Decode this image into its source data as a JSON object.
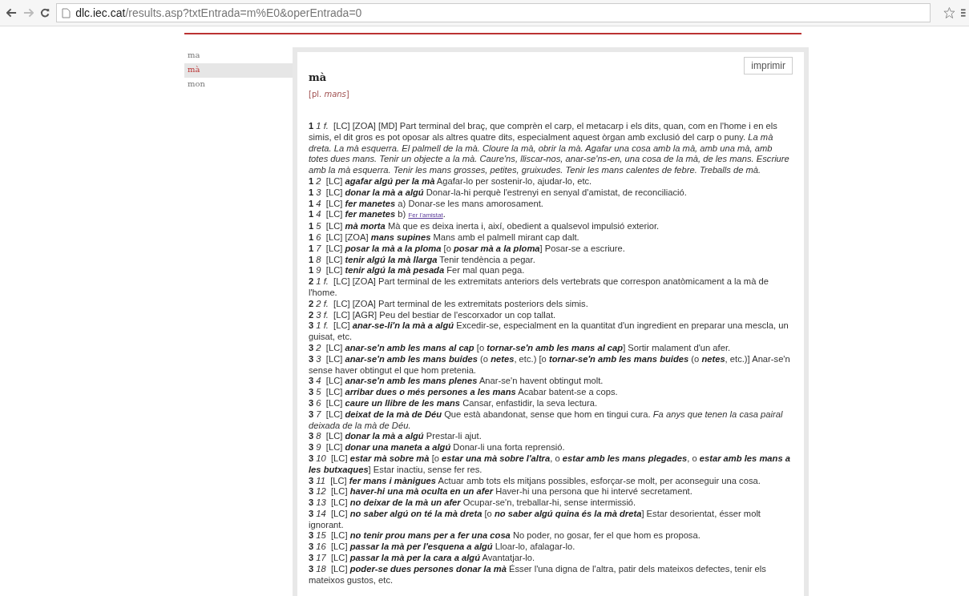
{
  "browser": {
    "url_host": "dlc.iec.cat",
    "url_path": "/results.asp?txtEntrada=m%E0&operEntrada=0"
  },
  "sidebar": {
    "items": [
      {
        "label": "ma",
        "selected": false
      },
      {
        "label": "mà",
        "selected": true
      },
      {
        "label": "mon",
        "selected": false
      }
    ]
  },
  "entry": {
    "headword": "mà",
    "print_button": "imprimir",
    "plural": "[pl. *mans*]",
    "senses": [
      {
        "num": "1",
        "sub": "1 f.",
        "text": "[LC] [ZOA] [MD] Part terminal del braç, que comprèn el carp, el metacarp i els dits, quan, com en l'home i en els simis, el dit gros es pot oposar als altres quatre dits, especialment aquest òrgan amb exclusió del carp o puny. *La mà dreta. La mà esquerra. El palmell de la mà. Cloure la mà, obrir la mà. Agafar una cosa amb la mà, amb una mà, amb totes dues mans. Tenir un objecte a la mà. Caure'ns, lliscar-nos, anar-se'ns-en, una cosa de la mà, de les mans. Escriure amb la mà esquerra. Tenir les mans grosses, petites, gruixudes. Tenir les mans calentes de febre. Treballs de mà.*"
      },
      {
        "num": "1",
        "sub": "2",
        "text": "[LC] **agafar algú per la mà** Agafar-lo per sostenir-lo, ajudar-lo, etc."
      },
      {
        "num": "1",
        "sub": "3",
        "text": "[LC] **donar la mà a algú** Donar-la-hi perquè l'estrenyi en senyal d'amistat, de reconciliació."
      },
      {
        "num": "1",
        "sub": "4",
        "text": "[LC] **fer manetes** a) Donar-se les mans amorosament."
      },
      {
        "num": "1",
        "sub": "4",
        "text": "[LC] **fer manetes** b)",
        "link": "Fer l'amistat",
        "tail": "."
      },
      {
        "num": "1",
        "sub": "5",
        "text": "[LC] **mà morta** Mà que es deixa inerta i, així, obedient a qualsevol impulsió exterior."
      },
      {
        "num": "1",
        "sub": "6",
        "text": "[LC] [ZOA] **mans supines** Mans amb el palmell mirant cap dalt."
      },
      {
        "num": "1",
        "sub": "7",
        "text": "[LC] **posar la mà a la ploma** [o **posar mà a la ploma**] Posar-se a escriure."
      },
      {
        "num": "1",
        "sub": "8",
        "text": "[LC] **tenir algú la mà llarga** Tenir tendència a pegar."
      },
      {
        "num": "1",
        "sub": "9",
        "text": "[LC] **tenir algú la mà pesada** Fer mal quan pega."
      },
      {
        "num": "2",
        "sub": "1 f.",
        "text": "[LC] [ZOA] Part terminal de les extremitats anteriors dels vertebrats que correspon anatòmicament a la mà de l'home."
      },
      {
        "num": "2",
        "sub": "2 f.",
        "text": "[LC] [ZOA] Part terminal de les extremitats posteriors dels simis."
      },
      {
        "num": "2",
        "sub": "3 f.",
        "text": "[LC] [AGR] Peu del bestiar de l'escorxador un cop tallat."
      },
      {
        "num": "3",
        "sub": "1 f.",
        "text": "[LC] **anar-se-li'n la mà a algú** Excedir-se, especialment en la quantitat d'un ingredient en preparar una mescla, un guisat, etc."
      },
      {
        "num": "3",
        "sub": "2",
        "text": "[LC] **anar-se'n amb les mans al cap** [o **tornar-se'n amb les mans al cap**] Sortir malament d'un afer."
      },
      {
        "num": "3",
        "sub": "3",
        "text": "[LC] **anar-se'n amb les mans buides** (o **netes**, etc.) [o **tornar-se'n amb les mans buides** (o **netes**, etc.)] Anar-se'n sense haver obtingut el que hom pretenia."
      },
      {
        "num": "3",
        "sub": "4",
        "text": "[LC] **anar-se'n amb les mans plenes** Anar-se'n havent obtingut molt."
      },
      {
        "num": "3",
        "sub": "5",
        "text": "[LC] **arribar dues o més persones a les mans** Acabar batent-se a cops."
      },
      {
        "num": "3",
        "sub": "6",
        "text": "[LC] **caure un llibre de les mans** Cansar, enfastidir, la seva lectura."
      },
      {
        "num": "3",
        "sub": "7",
        "text": "[LC] **deixat de la mà de Déu** Que està abandonat, sense que hom en tingui cura. *Fa anys que tenen la casa pairal deixada de la mà de Déu.*"
      },
      {
        "num": "3",
        "sub": "8",
        "text": "[LC] **donar la mà a algú** Prestar-li ajut."
      },
      {
        "num": "3",
        "sub": "9",
        "text": "[LC] **donar una maneta a algú** Donar-li una forta reprensió."
      },
      {
        "num": "3",
        "sub": "10",
        "text": "[LC] **estar mà sobre mà** [o **estar una mà sobre l'altra**, o **estar amb les mans plegades**, o **estar amb les mans a les butxaques**] Estar inactiu, sense fer res."
      },
      {
        "num": "3",
        "sub": "11",
        "text": "[LC] **fer mans i mànigues** Actuar amb tots els mitjans possibles, esforçar-se molt, per aconseguir una cosa."
      },
      {
        "num": "3",
        "sub": "12",
        "text": "[LC] **haver-hi una mà oculta en un afer** Haver-hi una persona que hi intervé secretament."
      },
      {
        "num": "3",
        "sub": "13",
        "text": "[LC] **no deixar de la mà un afer** Ocupar-se'n, treballar-hi, sense intermissió."
      },
      {
        "num": "3",
        "sub": "14",
        "text": "[LC] **no saber algú on té la mà dreta** [o **no saber algú quina és la mà dreta**] Estar desorientat, ésser molt ignorant."
      },
      {
        "num": "3",
        "sub": "15",
        "text": "[LC] **no tenir prou mans per a fer una cosa** No poder, no gosar, fer el que hom es proposa."
      },
      {
        "num": "3",
        "sub": "16",
        "text": "[LC] **passar la mà per l'esquena a algú** Lloar-lo, afalagar-lo."
      },
      {
        "num": "3",
        "sub": "17",
        "text": "[LC] **passar la mà per la cara a algú** Avantatjar-lo."
      },
      {
        "num": "3",
        "sub": "18",
        "text": "[LC] **poder-se dues persones donar la mà** Ésser l'una digna de l'altra, patir dels mateixos defectes, tenir els mateixos gustos, etc."
      }
    ]
  }
}
